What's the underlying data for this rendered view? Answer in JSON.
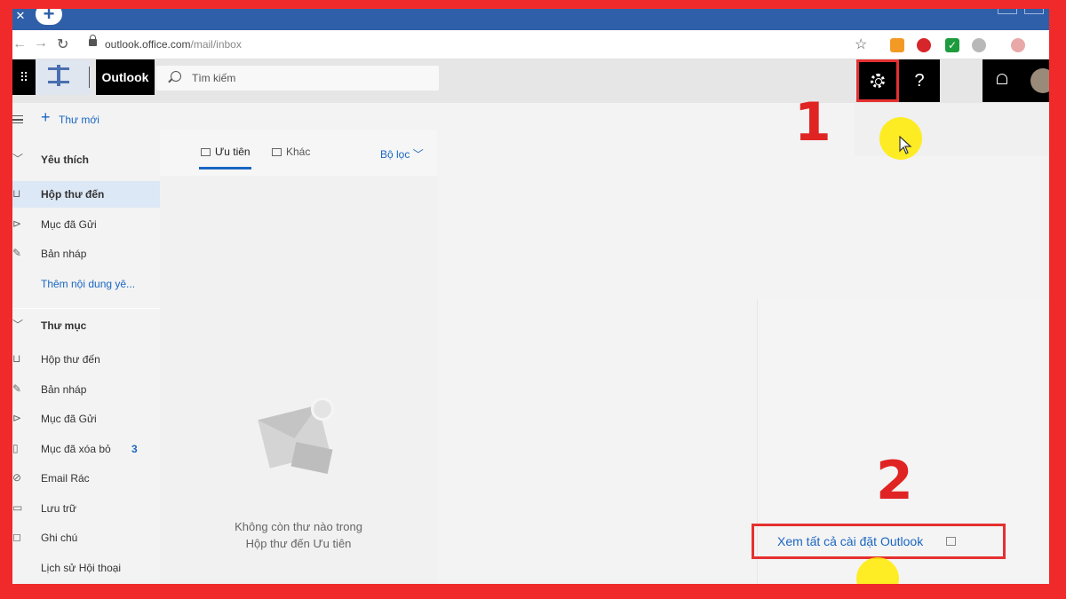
{
  "browser": {
    "url_host": "outlook.office.com",
    "url_path": "/mail/inbox",
    "tab_close_icon": "close-icon",
    "new_tab_icon": "plus-icon"
  },
  "header": {
    "brand": "Outlook",
    "search_placeholder": "Tìm kiếm",
    "help_label": "?"
  },
  "sidebar": {
    "new_mail": "Thư mới",
    "favorites_title": "Yêu thích",
    "favorites": [
      {
        "label": "Hộp thư đến",
        "icon": "inbox-icon",
        "active": true
      },
      {
        "label": "Mục đã Gửi",
        "icon": "send-icon"
      },
      {
        "label": "Bản nháp",
        "icon": "pencil-icon"
      },
      {
        "label": "Thêm nội dung yê...",
        "icon": "",
        "link": true
      }
    ],
    "folders_title": "Thư mục",
    "folders": [
      {
        "label": "Hộp thư đến",
        "icon": "inbox-icon"
      },
      {
        "label": "Bản nháp",
        "icon": "pencil-icon"
      },
      {
        "label": "Mục đã Gửi",
        "icon": "send-icon"
      },
      {
        "label": "Mục đã xóa bỏ",
        "icon": "trash-icon",
        "count": "3"
      },
      {
        "label": "Email Rác",
        "icon": "block-icon"
      },
      {
        "label": "Lưu trữ",
        "icon": "archive-icon"
      },
      {
        "label": "Ghi chú",
        "icon": "note-icon"
      },
      {
        "label": "Lịch sử Hội thoại",
        "icon": ""
      }
    ]
  },
  "message_list": {
    "tab_focused": "Ưu tiên",
    "tab_other": "Khác",
    "filter": "Bộ lọc",
    "empty_line1": "Không còn thư nào trong",
    "empty_line2": "Hộp thư đến Ưu tiên"
  },
  "settings": {
    "view_all": "Xem tất cả cài đặt Outlook"
  },
  "annotations": {
    "step1": "1",
    "step2": "2",
    "accent_color": "#e02424"
  }
}
